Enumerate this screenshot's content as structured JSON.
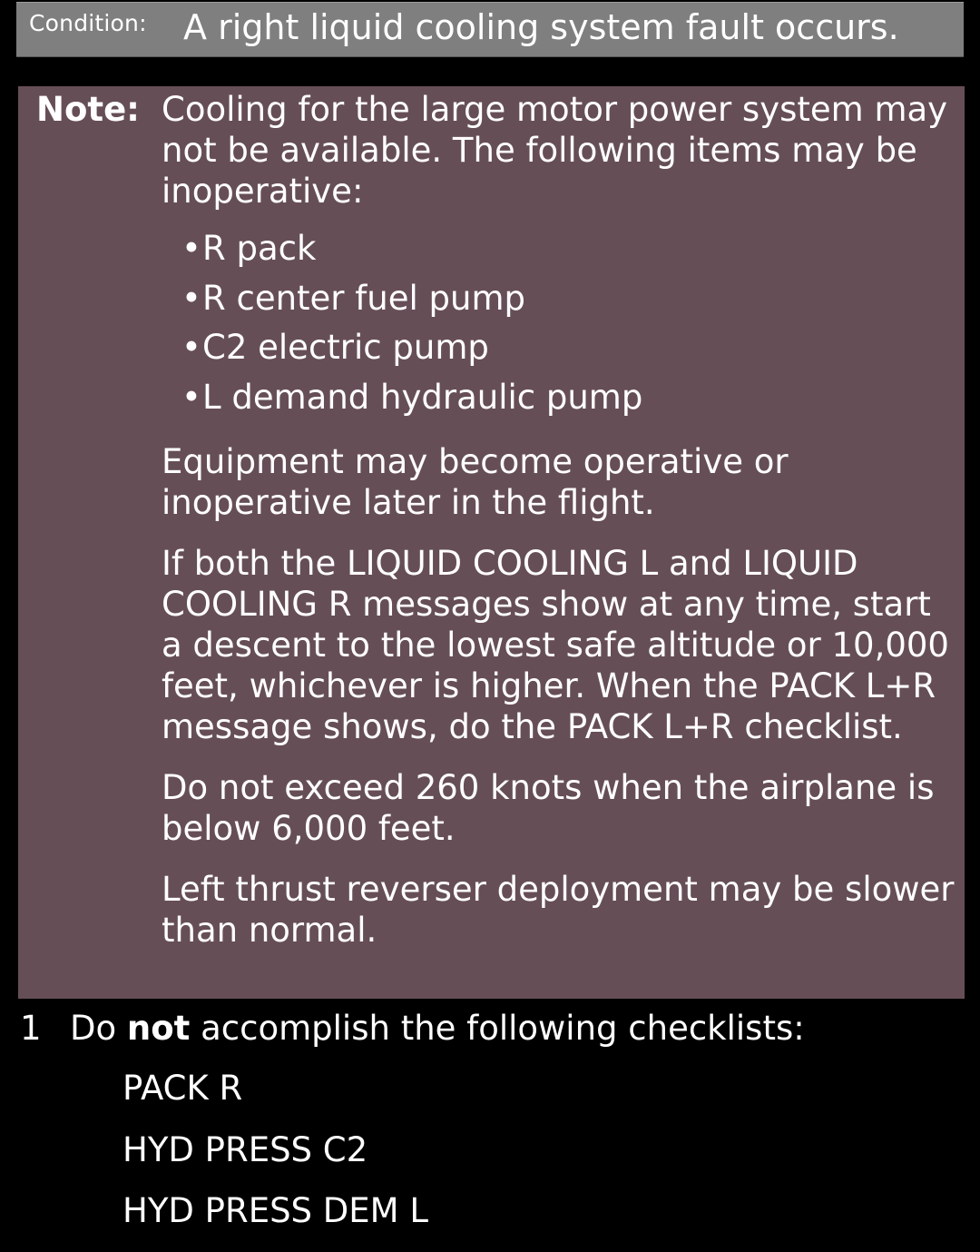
{
  "condition": {
    "label": "Condition:",
    "text": "A right liquid cooling system fault occurs."
  },
  "note": {
    "label": "Note:",
    "intro": "Cooling for the large motor power system may not be available. The following items may be inoperative:",
    "items": [
      "R pack",
      "R center fuel pump",
      "C2 electric pump",
      "L demand hydraulic pump"
    ],
    "paragraphs": [
      "Equipment may become operative or inoperative later in the flight.",
      "If both the LIQUID COOLING L and LIQUID COOLING R messages show at any time, start a descent to the lowest safe altitude or 10,000 feet, whichever is higher. When the PACK L+R message shows, do the PACK L+R checklist.",
      "Do not exceed 260 knots when the airplane is below 6,000 feet.",
      "Left thrust reverser deployment may be slower than normal."
    ]
  },
  "step1": {
    "number": "1",
    "prefix": "Do",
    "emphasis": "not",
    "suffix": "accomplish the following checklists:",
    "checklists": [
      "PACK R",
      "HYD PRESS C2",
      "HYD PRESS DEM L"
    ]
  },
  "colors": {
    "background": "#000000",
    "condition_bar": "#7f7f7f",
    "note_box": "#664e57",
    "text": "#ffffff"
  }
}
